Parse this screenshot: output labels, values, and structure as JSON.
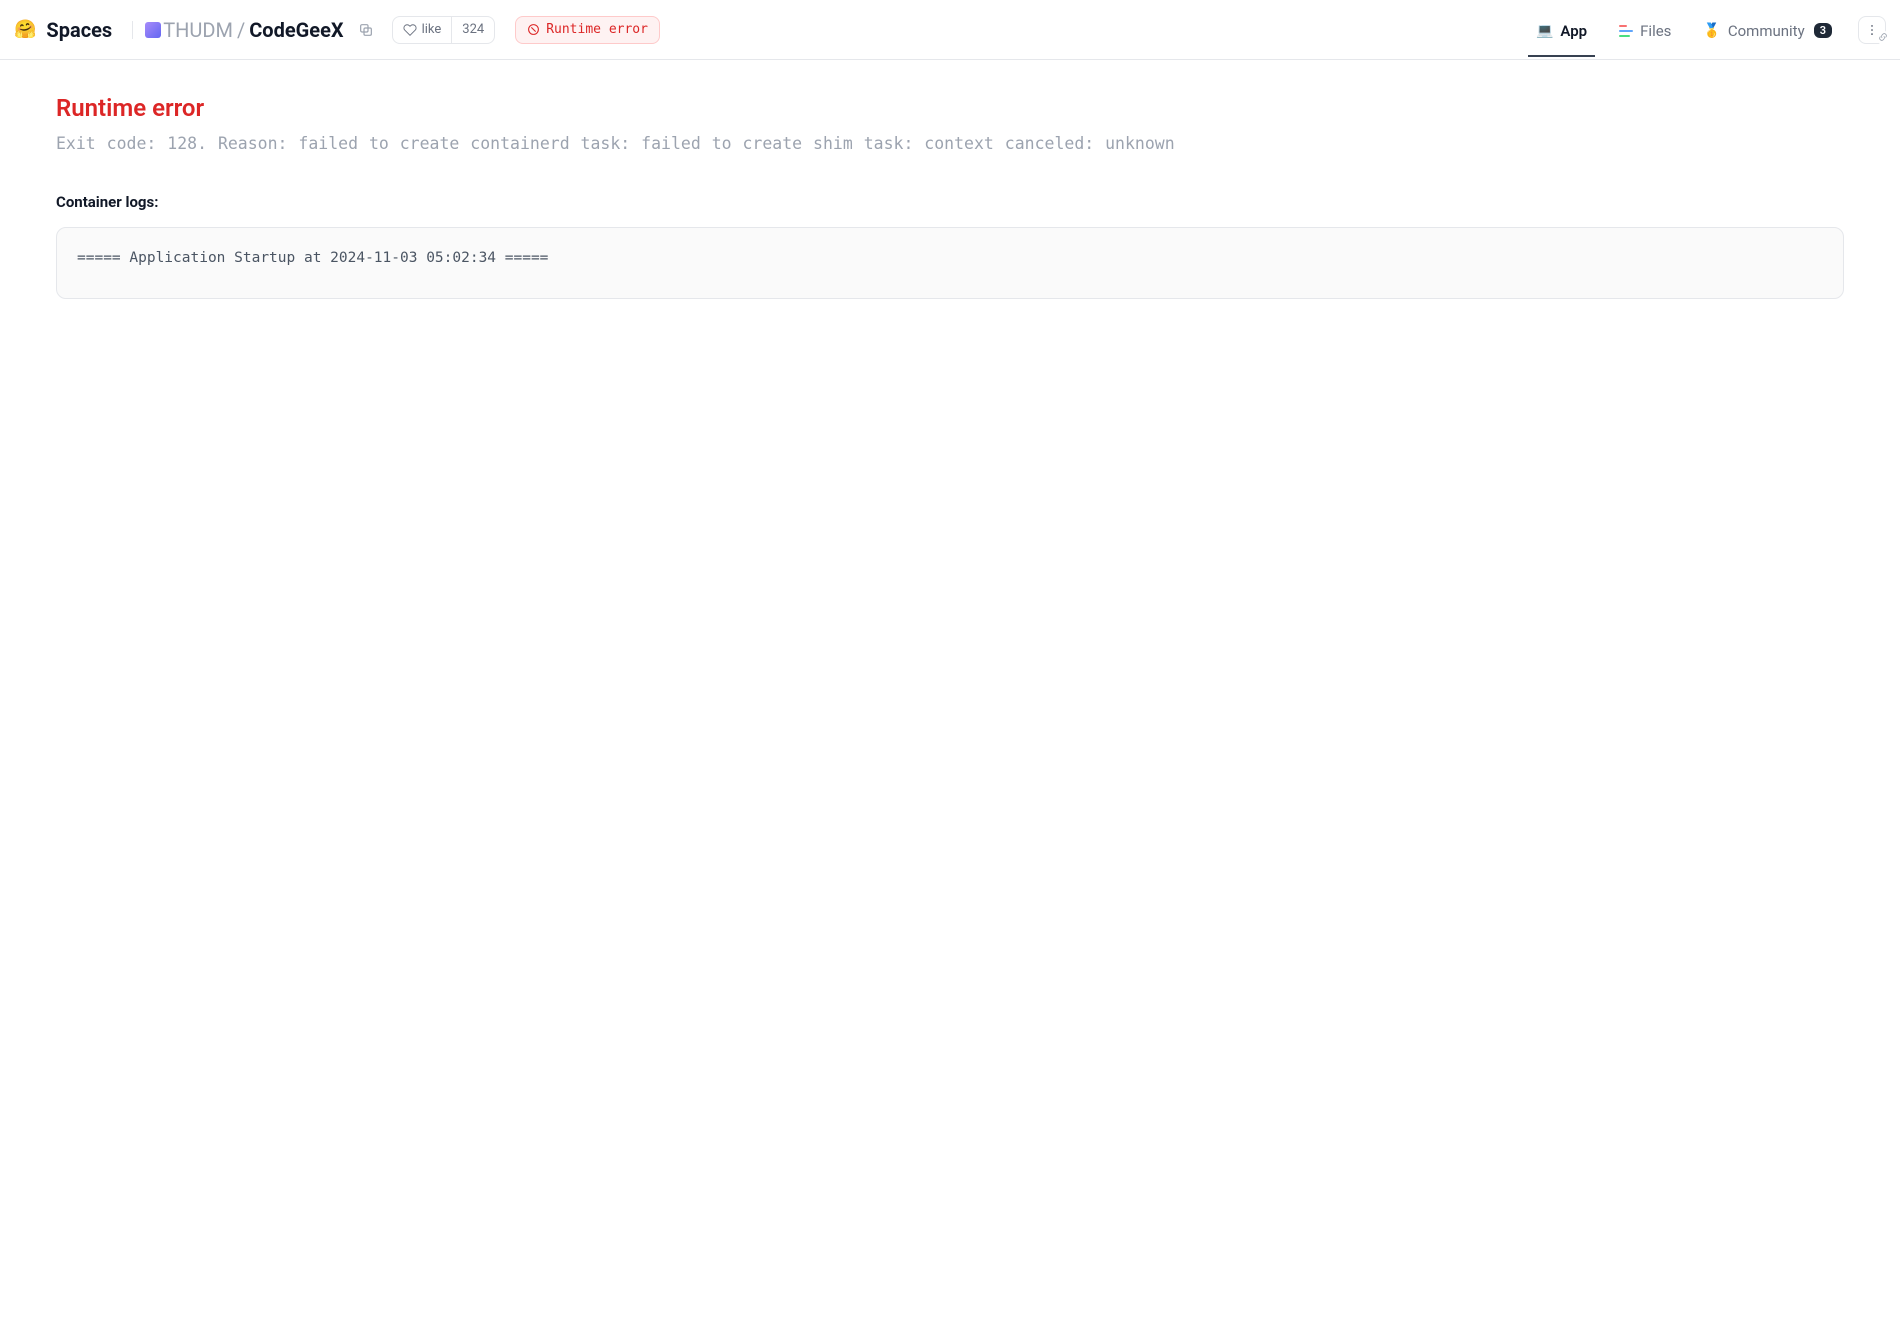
{
  "header": {
    "spaces_emoji": "🤗",
    "spaces_title": "Spaces",
    "breadcrumb": {
      "org": "THUDM",
      "sep": "/",
      "repo": "CodeGeeX"
    },
    "like": {
      "label": "like",
      "count": "324"
    },
    "status": {
      "label": "Runtime error"
    },
    "tabs": {
      "app": {
        "emoji": "💻",
        "label": "App"
      },
      "files": {
        "label": "Files"
      },
      "community": {
        "emoji": "🥇",
        "label": "Community",
        "count": "3"
      }
    }
  },
  "main": {
    "error_title": "Runtime error",
    "error_reason": "Exit code: 128. Reason: failed to create containerd task: failed to create shim task: context canceled: unknown",
    "logs_title": "Container logs:",
    "logs_content": "===== Application Startup at 2024-11-03 05:02:34 ====="
  }
}
